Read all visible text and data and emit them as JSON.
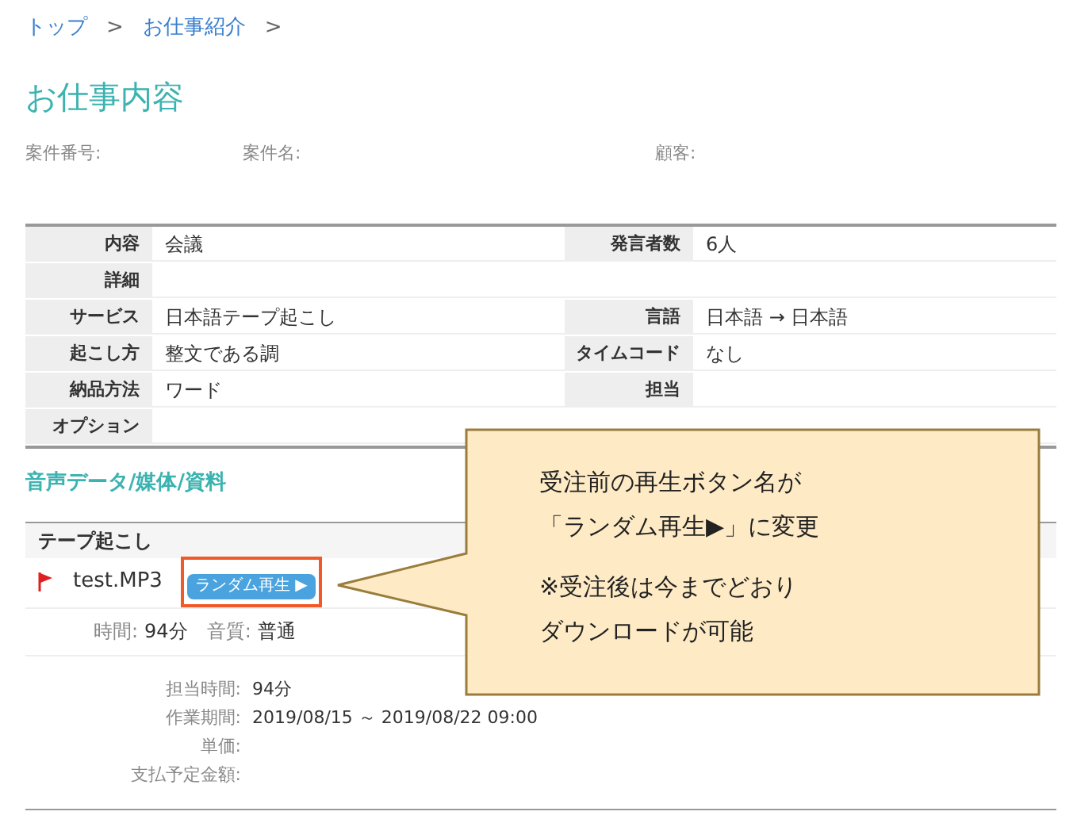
{
  "breadcrumb": [
    "トップ",
    "お仕事紹介"
  ],
  "breadcrumb_separator": ">",
  "title": "お仕事内容",
  "meta": [
    {
      "label": "案件番号:"
    },
    {
      "label": "案件名:"
    },
    {
      "label": "顧客:"
    }
  ],
  "details": [
    {
      "label": "内容",
      "value": "会議",
      "label2": "発言者数",
      "value2": "6人"
    },
    {
      "label": "詳細"
    },
    {
      "label": "サービス",
      "value": "日本語テープ起こし",
      "label2": "言語",
      "value2": "日本語 → 日本語"
    },
    {
      "label": "起こし方",
      "value": "整文である調",
      "label2": "タイムコード",
      "value2": "なし"
    },
    {
      "label": "納品方法",
      "value": "ワード",
      "label2": "担当"
    },
    {
      "label": "オプション"
    }
  ],
  "section_title": "音声データ/媒体/資料",
  "file_group": {
    "header": "テープ起こし",
    "file_name": "test.MP3",
    "flagged": true,
    "play_button": "ランダム再生 ▶",
    "highlighted": true,
    "stats": [
      {
        "label": "時間:",
        "value": "94分"
      },
      {
        "label": "音質:",
        "value": "普通"
      }
    ],
    "info": [
      {
        "label": "担当時間:",
        "value": "94分"
      },
      {
        "label": "作業期間:",
        "value": "2019/08/15 ～ 2019/08/22 09:00"
      },
      {
        "label": "単価:"
      },
      {
        "label": "支払予定金額:"
      }
    ]
  },
  "callout": {
    "paragraphs": [
      [
        "受注前の再生ボタン名が",
        "「ランダム再生▶」に変更"
      ],
      [
        "※受注後は今までどおり",
        "ダウンロードが可能"
      ]
    ]
  }
}
